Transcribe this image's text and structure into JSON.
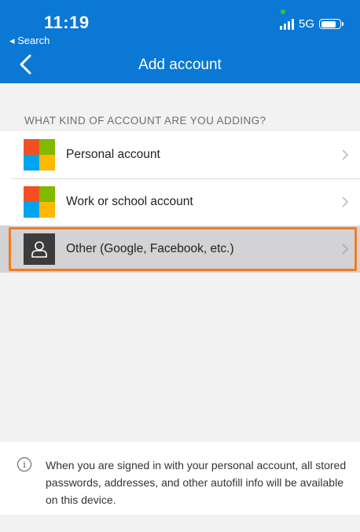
{
  "status_bar": {
    "time": "11:19",
    "back_label": "◂ Search",
    "network": "5G"
  },
  "nav": {
    "title": "Add account"
  },
  "section": {
    "label": "WHAT KIND OF ACCOUNT ARE YOU ADDING?"
  },
  "accounts": [
    {
      "label": "Personal account",
      "icon": "microsoft-logo-icon"
    },
    {
      "label": "Work or school account",
      "icon": "microsoft-logo-icon"
    },
    {
      "label": "Other (Google, Facebook, etc.)",
      "icon": "person-icon",
      "highlighted": true
    }
  ],
  "footer": {
    "info_text": "When you are signed in with your personal account, all stored passwords, addresses, and other autofill info will be available on this device."
  },
  "colors": {
    "header_bg": "#0a78d4",
    "highlight_border": "#f07b1f",
    "ms_red": "#f25022",
    "ms_green": "#7fba00",
    "ms_blue": "#00a4ef",
    "ms_yellow": "#ffb900"
  }
}
